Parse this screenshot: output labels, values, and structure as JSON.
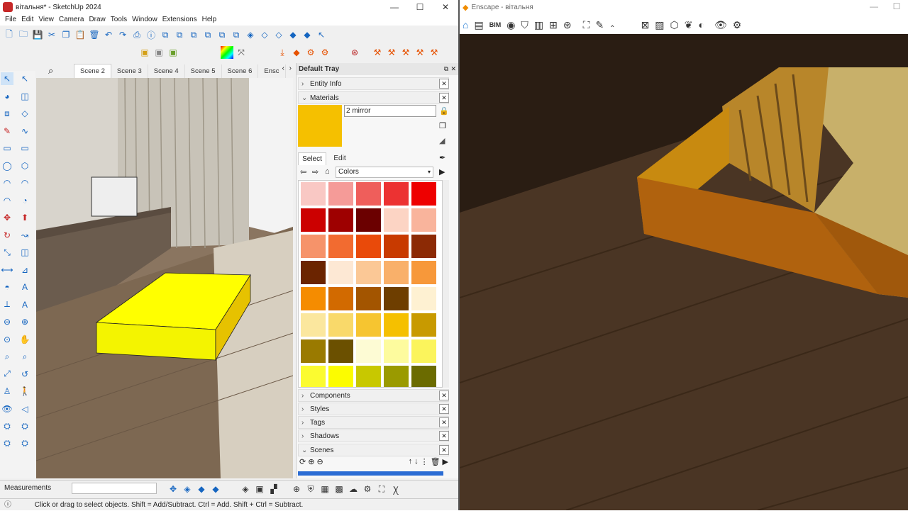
{
  "sketchup": {
    "title": "вітальня* - SketchUp 2024",
    "menu": [
      "File",
      "Edit",
      "View",
      "Camera",
      "Draw",
      "Tools",
      "Window",
      "Extensions",
      "Help"
    ],
    "scenes": [
      "Scene 2",
      "Scene 3",
      "Scene 4",
      "Scene 5",
      "Scene 6",
      "Ensc"
    ],
    "measurements_label": "Measurements",
    "status": "Click or drag to select objects. Shift = Add/Subtract. Ctrl = Add. Shift + Ctrl = Subtract."
  },
  "tray": {
    "title": "Default Tray",
    "entity_info": "Entity Info",
    "materials": "Materials",
    "material_name": "2 mirror",
    "material_color": "#f5c000",
    "tab_select": "Select",
    "tab_edit": "Edit",
    "library": "Colors",
    "swatches": [
      "#f9c8c4",
      "#f59b98",
      "#ef5e5b",
      "#ec3232",
      "#ee0000",
      "#cc0000",
      "#9e0000",
      "#6b0000",
      "#fcd4c4",
      "#f9b49c",
      "#f6936a",
      "#f26b30",
      "#e94a0a",
      "#c83a00",
      "#8c2a05",
      "#6b2400",
      "#fde8d4",
      "#fbc896",
      "#f9b06a",
      "#f7983a",
      "#f58c00",
      "#d26a00",
      "#a35500",
      "#6e3e00",
      "#fef1d2",
      "#fbe79e",
      "#f9d96a",
      "#f6c530",
      "#f5c000",
      "#c89a00",
      "#9a7a00",
      "#6b5000",
      "#fdfbd4",
      "#fdfb9e",
      "#fbf45c",
      "#fbfb30",
      "#fcfc00",
      "#c8c800",
      "#9a9a00",
      "#6b6b00"
    ],
    "panels": [
      "Components",
      "Styles",
      "Tags",
      "Shadows",
      "Scenes"
    ]
  },
  "enscape": {
    "title": "Enscape - вітальня"
  }
}
